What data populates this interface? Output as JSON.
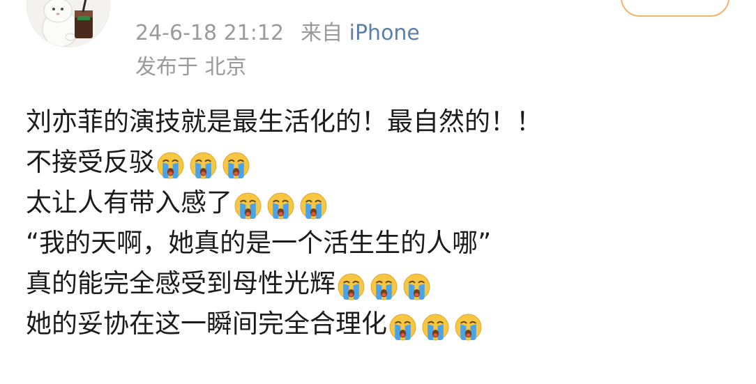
{
  "post": {
    "timestamp": "24-6-18 21:12",
    "source_prefix": "来自",
    "source_device": "iPhone",
    "location": "发布于 北京",
    "lines": [
      {
        "text": "刘亦菲的演技就是最生活化的！最自然的！！",
        "emoji_count": 0
      },
      {
        "text": "不接受反驳",
        "emoji_count": 3
      },
      {
        "text": "太让人有带入感了",
        "emoji_count": 3
      },
      {
        "text": "“我的天啊，她真的是一个活生生的人哪”",
        "emoji_count": 0
      },
      {
        "text": "真的能完全感受到母性光辉",
        "emoji_count": 3
      },
      {
        "text": "她的妥协在这一瞬间完全合理化",
        "emoji_count": 3
      }
    ],
    "emoji_icon": "crying-face-icon"
  },
  "colors": {
    "text": "#1b1b1b",
    "meta": "#9a9a9a",
    "source_link": "#5b7fa8",
    "follow_border": "#f3b36a",
    "emoji_face": "#f7c744",
    "emoji_tears": "#4aa3e8"
  }
}
